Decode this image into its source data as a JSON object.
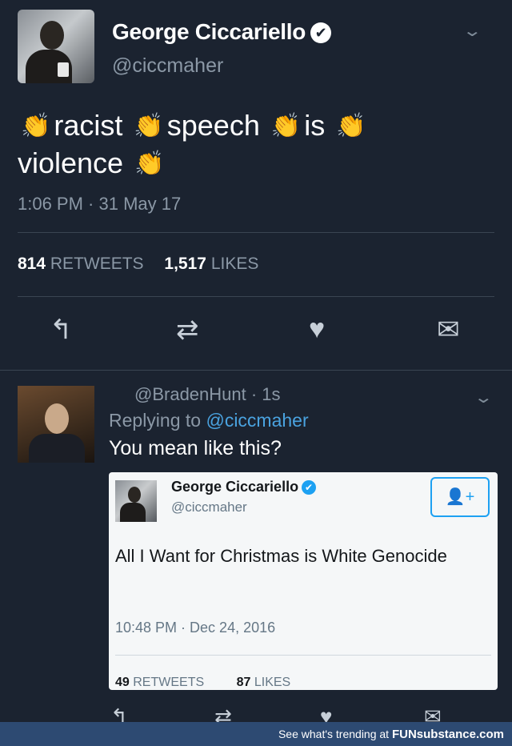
{
  "main_tweet": {
    "display_name": "George Ciccariello",
    "verified_glyph": "✔",
    "handle": "@ciccmaher",
    "words": [
      "racist",
      "speech",
      "is",
      "violence"
    ],
    "clap_glyph": "👏",
    "timestamp": "1:06 PM · 31 May 17",
    "retweets_count": "814",
    "retweets_label": "RETWEETS",
    "likes_count": "1,517",
    "likes_label": "LIKES",
    "actions": {
      "reply_icon": "↰",
      "retweet_icon": "⇄",
      "like_icon": "♥",
      "dm_icon": "✉"
    }
  },
  "reply": {
    "handle_time": "@BradenHunt · 1s",
    "replying_prefix": "Replying to",
    "replying_mention": "@ciccmaher",
    "text": "You mean like this?",
    "embedded": {
      "display_name": "George Ciccariello",
      "verified_glyph": "✔",
      "handle": "@ciccmaher",
      "follow_glyph": "👤+",
      "text": "All I Want for Christmas is White Genocide",
      "timestamp": "10:48 PM · Dec 24, 2016",
      "retweets_count": "49",
      "retweets_label": "RETWEETS",
      "likes_count": "87",
      "likes_label": "LIKES"
    }
  },
  "footer": {
    "prefix": "See what's trending at",
    "brand": "FUNsubstance.com"
  },
  "icons": {
    "chevron": "⌄"
  }
}
